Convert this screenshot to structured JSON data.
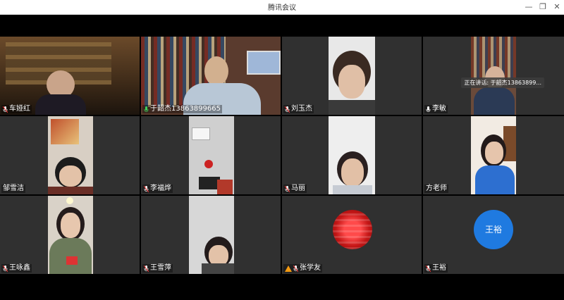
{
  "window": {
    "title": "腾讯会议",
    "min": "—",
    "restore": "❐",
    "close": "✕"
  },
  "speaking": "正在讲话: 于韶杰13863899...",
  "participants": [
    {
      "name": "车娅红"
    },
    {
      "name": "于韶杰13863899665"
    },
    {
      "name": "刘玉杰"
    },
    {
      "name": "李敏"
    },
    {
      "name": "邹雪洁"
    },
    {
      "name": "李福烨"
    },
    {
      "name": "马丽"
    },
    {
      "name": "方老师"
    },
    {
      "name": "王咏鑫"
    },
    {
      "name": "王雪萍"
    },
    {
      "name": "张学友"
    },
    {
      "name": "王裕",
      "avatar_text": "王裕"
    }
  ]
}
